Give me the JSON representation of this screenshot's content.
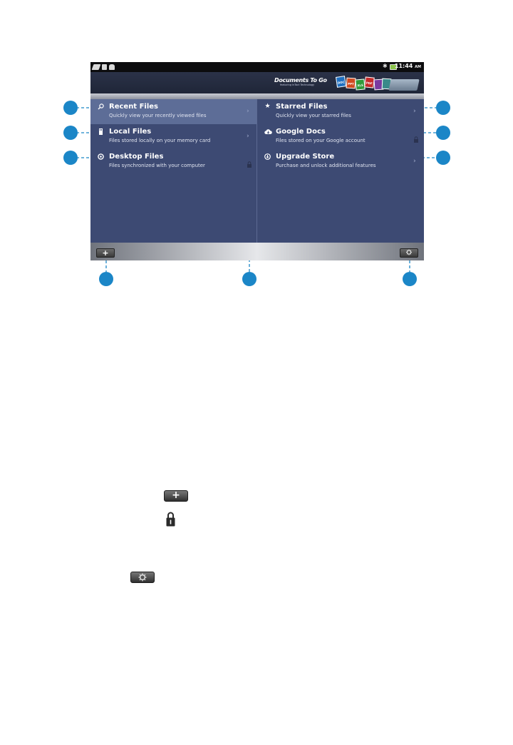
{
  "status_bar": {
    "time": "11:44",
    "ampm": "AM"
  },
  "header": {
    "brand": "Documents To Go",
    "brand_sub": "featuring InTact Technology",
    "tiles": [
      {
        "label": "DOC",
        "color": "#1f6fc0"
      },
      {
        "label": "PPT",
        "color": "#d04a20"
      },
      {
        "label": "XLS",
        "color": "#2f9a3a"
      },
      {
        "label": "PDF",
        "color": "#c52a2a"
      },
      {
        "label": "",
        "color": "#7a3aa0"
      },
      {
        "label": "",
        "color": "#3a8a8a"
      }
    ]
  },
  "left_items": [
    {
      "title": "Recent Files",
      "subtitle": "Quickly view your recently viewed files",
      "icon": "search-icon",
      "trailing": "chevron"
    },
    {
      "title": "Local Files",
      "subtitle": "Files stored locally on your memory card",
      "icon": "sd-card-icon",
      "trailing": "chevron"
    },
    {
      "title": "Desktop Files",
      "subtitle": "Files synchronized with your computer",
      "icon": "sync-icon",
      "trailing": "lock"
    }
  ],
  "right_items": [
    {
      "title": "Starred Files",
      "subtitle": "Quickly view your starred files",
      "icon": "star-icon",
      "trailing": "chevron"
    },
    {
      "title": "Google Docs",
      "subtitle": "Files stored on your Google account",
      "icon": "cloud-icon",
      "trailing": "lock"
    },
    {
      "title": "Upgrade Store",
      "subtitle": "Purchase and unlock additional features",
      "icon": "download-icon",
      "trailing": "chevron"
    }
  ],
  "bottom_bar": {
    "add_label": "+",
    "settings_icon": "settings-icon"
  },
  "legend": {
    "add_label": "+",
    "lock_icon": "lock-icon",
    "settings_icon": "settings-icon"
  },
  "colors": {
    "callout": "#1b86c7",
    "panel": "#3d4a73",
    "selected": "#5d6d97"
  }
}
